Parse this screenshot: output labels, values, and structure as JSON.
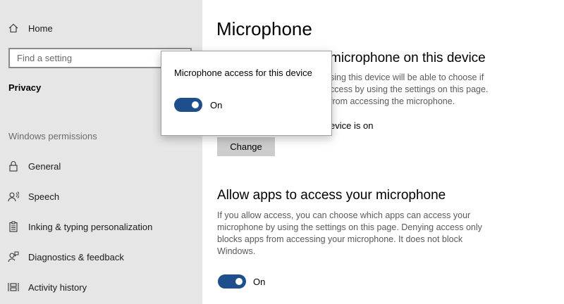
{
  "sidebar": {
    "home_label": "Home",
    "search_placeholder": "Find a setting",
    "category": "Privacy",
    "section_label": "Windows permissions",
    "items": [
      {
        "label": "General",
        "icon": "lock-icon"
      },
      {
        "label": "Speech",
        "icon": "speech-icon"
      },
      {
        "label": "Inking & typing personalization",
        "icon": "clipboard-icon"
      },
      {
        "label": "Diagnostics & feedback",
        "icon": "feedback-icon"
      },
      {
        "label": "Activity history",
        "icon": "timeline-icon"
      }
    ]
  },
  "main": {
    "title": "Microphone",
    "device_section": {
      "title_visible": "microphone on this device",
      "desc_lines": [
        "sing this device will be able to choose if",
        "ccess by using the settings on this page.",
        "from accessing the microphone."
      ],
      "status_visible": "evice is on",
      "change_button": "Change"
    },
    "apps_section": {
      "title": "Allow apps to access your microphone",
      "desc": "If you allow access, you can choose which apps can access your microphone by using the settings on this page. Denying access only blocks apps from accessing your microphone. It does not block Windows.",
      "toggle_label": "On",
      "toggle_on": true
    }
  },
  "flyout": {
    "title": "Microphone access for this device",
    "toggle_label": "On",
    "toggle_on": true
  },
  "colors": {
    "accent": "#1f4e8c",
    "sidebar_bg": "#e6e6e6",
    "button_bg": "#cccccc"
  }
}
